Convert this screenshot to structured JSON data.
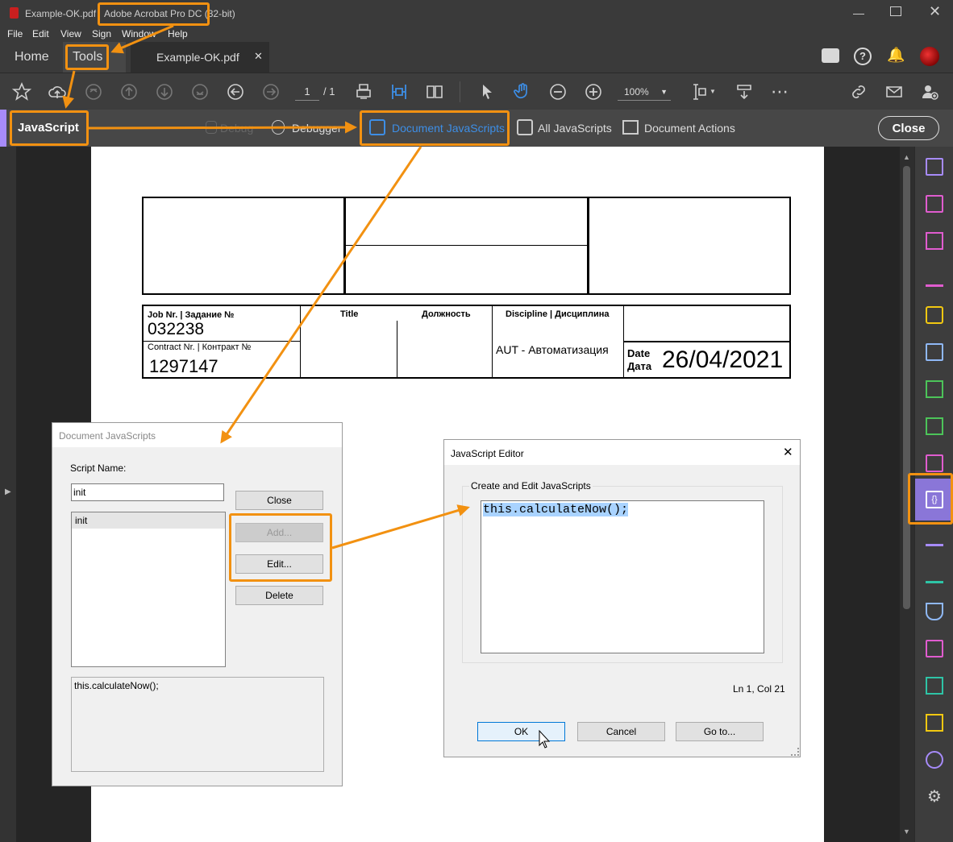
{
  "window": {
    "title_file": "Example-OK.pdf",
    "title_app": "Adobe Acrobat Pro DC (32-bit)"
  },
  "menu": [
    "File",
    "Edit",
    "View",
    "Sign",
    "Window",
    "Help"
  ],
  "tabs": {
    "home": "Home",
    "tools": "Tools",
    "document": "Example-OK.pdf"
  },
  "toolbar": {
    "page_current": "1",
    "page_total": "/ 1",
    "zoom": "100%"
  },
  "jsbar": {
    "label": "JavaScript",
    "debug": "Debug",
    "debugger": "Debugger",
    "doc_js": "Document JavaScripts",
    "all_js": "All JavaScripts",
    "doc_actions": "Document Actions",
    "close": "Close"
  },
  "pdf": {
    "job_label": "Job Nr. | Задание №",
    "job_value": "032238",
    "contract_label": "Contract Nr. | Контракт №",
    "contract_value": "1297147",
    "title_label": "Title",
    "position_label": "Должность",
    "discipline_label": "Discipline | Дисциплина",
    "discipline_value": "AUT - Автоматизация",
    "date_label_en": "Date",
    "date_label_ru": "Дата",
    "date_value": "26/04/2021"
  },
  "doc_js_dialog": {
    "title": "Document JavaScripts",
    "script_name_label": "Script Name:",
    "script_name_value": "init",
    "list_items": [
      "init"
    ],
    "close": "Close",
    "add": "Add...",
    "edit": "Edit...",
    "delete": "Delete",
    "preview": "this.calculateNow();"
  },
  "js_editor": {
    "title": "JavaScript Editor",
    "group_label": "Create and Edit JavaScripts",
    "code": "this.calculateNow();",
    "position": "Ln 1, Col 21",
    "ok": "OK",
    "cancel": "Cancel",
    "goto": "Go to..."
  },
  "colors": {
    "accent": "#f29111",
    "blue": "#3d8ee6",
    "purple": "#a78bfa",
    "teal": "#2ec4a6"
  }
}
